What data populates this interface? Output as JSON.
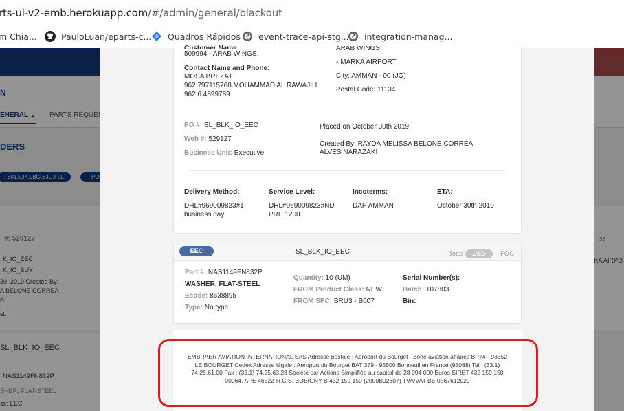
{
  "browser": {
    "url_prefix": "rts-ui-v2-emb.herokuapp.com",
    "url_path": "/#/admin/general/blackout",
    "bookmarks": [
      {
        "label": "m Chia...",
        "icon": "page-icon"
      },
      {
        "label": "PauloLuan/eparts-c...",
        "icon": "github-icon"
      },
      {
        "label": "Quadros Rápidos",
        "icon": "diamond-icon"
      },
      {
        "label": "event-trace-api-stg....",
        "icon": "globe-icon"
      },
      {
        "label": "integration-manag...",
        "icon": "globe-icon"
      }
    ]
  },
  "background": {
    "app_initial": "N",
    "tab_general": "ENERAL",
    "tab_parts": "PARTS REQUES",
    "section_title": "DERS",
    "filter_chip": ": SIN,SJK,LBG,BJG,FLL",
    "filter_chip2": "PO",
    "left_lines": [
      "#: 529127",
      "K_IO_EEC",
      "K_IO_BUY",
      "30, 2019 Created By:",
      "A BELONE CORREA",
      "KI",
      "st:"
    ],
    "po_bottom": "SL_BLK_IO_EEC",
    "part_bottom": "NAS1149FN832P",
    "desc_bottom": "SHER, FLAT-STEEL",
    "class_bottom": "ss: EEC",
    "right_col1": "ss",
    "right_col2": "RKA AIRPO"
  },
  "order": {
    "customer_label_partial": "Customer Name:",
    "customer_value": "509994 - ARAB WINGS.",
    "contact_label": "Contact Name and Phone:",
    "contact_lines": [
      "MOSA BREZAT",
      "962 797115768 MOHAMMAD AL RAWAJIH",
      "962 6 4899789"
    ],
    "ship_lines": [
      "ARAB WINGS",
      "- MARKA AIRPORT",
      "City: AMMAN - 00 (JO)",
      "Postal Code: 11134"
    ],
    "po_label": "PO #:",
    "po_value": "SL_BLK_IO_EEC",
    "web_label": "Web #:",
    "web_value": "529127",
    "bu_label": "Business Unit:",
    "bu_value": "Executive",
    "placed": "Placed on October 30th 2019",
    "created_by_line1": "Created By: RAYDA MELISSA BELONE CORREA",
    "created_by_line2": "ALVES NARAZAKI",
    "delivery_label": "Delivery Method:",
    "delivery_lines": [
      "DHL#969009823#1",
      "business day"
    ],
    "service_label": "Service Level:",
    "service_lines": [
      "DHL#969009823#ND",
      "PRE 1200"
    ],
    "incoterms_label": "Incoterms:",
    "incoterms_value": "DAP AMMAN",
    "eta_label": "ETA:",
    "eta_value": "October 30th 2019"
  },
  "item": {
    "badge": "EEC",
    "po": "SL_BLK_IO_EEC",
    "total_label": "Total",
    "currency_selected": "USD",
    "currency_other": "FOC",
    "part_label": "Part #:",
    "part_value": "NAS1149FN832P",
    "description": "WASHER, FLAT-STEEL",
    "ecode_label": "Ecode:",
    "ecode_value": "8638895",
    "type_label": "Type:",
    "type_value": "No type",
    "qty_label": "Quantity:",
    "qty_value": "10 (UM)",
    "from_class_label": "FROM Product Class:",
    "from_class_value": "NEW",
    "from_spc_label": "FROM SPC:",
    "from_spc_value": "BRU3 - B007",
    "serial_label": "Serial Number(s):",
    "batch_label": "Batch:",
    "batch_value": "107803",
    "bin_label": "Bin:"
  },
  "footer": {
    "lines": [
      "EMBRAER AVIATION INTERNATIONAL SAS Adresse postale : Aeroport du Bourget - Zone aviation affaires BP74 - 93352",
      "LE BOURGET Cedex Adresse légale : Aeroport du Bourget BAT 379 - 95500 Bonneuil en France (95088) Tel : (33.1)",
      "74.25.61.00 Fax : (33.1) 74.25.63.28 Société par Actions Simplifiée au capital de 28 094 000 Euros SIRET 432 159 150",
      "00064. APE 4652Z R.C.S. BOBIGNY B 432 159 150 (2000B02607) TVA/VAT BE 0567612029"
    ]
  },
  "colors": {
    "header": "#13387a",
    "badge": "#4c6aa0",
    "highlight": "#e01b1b"
  }
}
